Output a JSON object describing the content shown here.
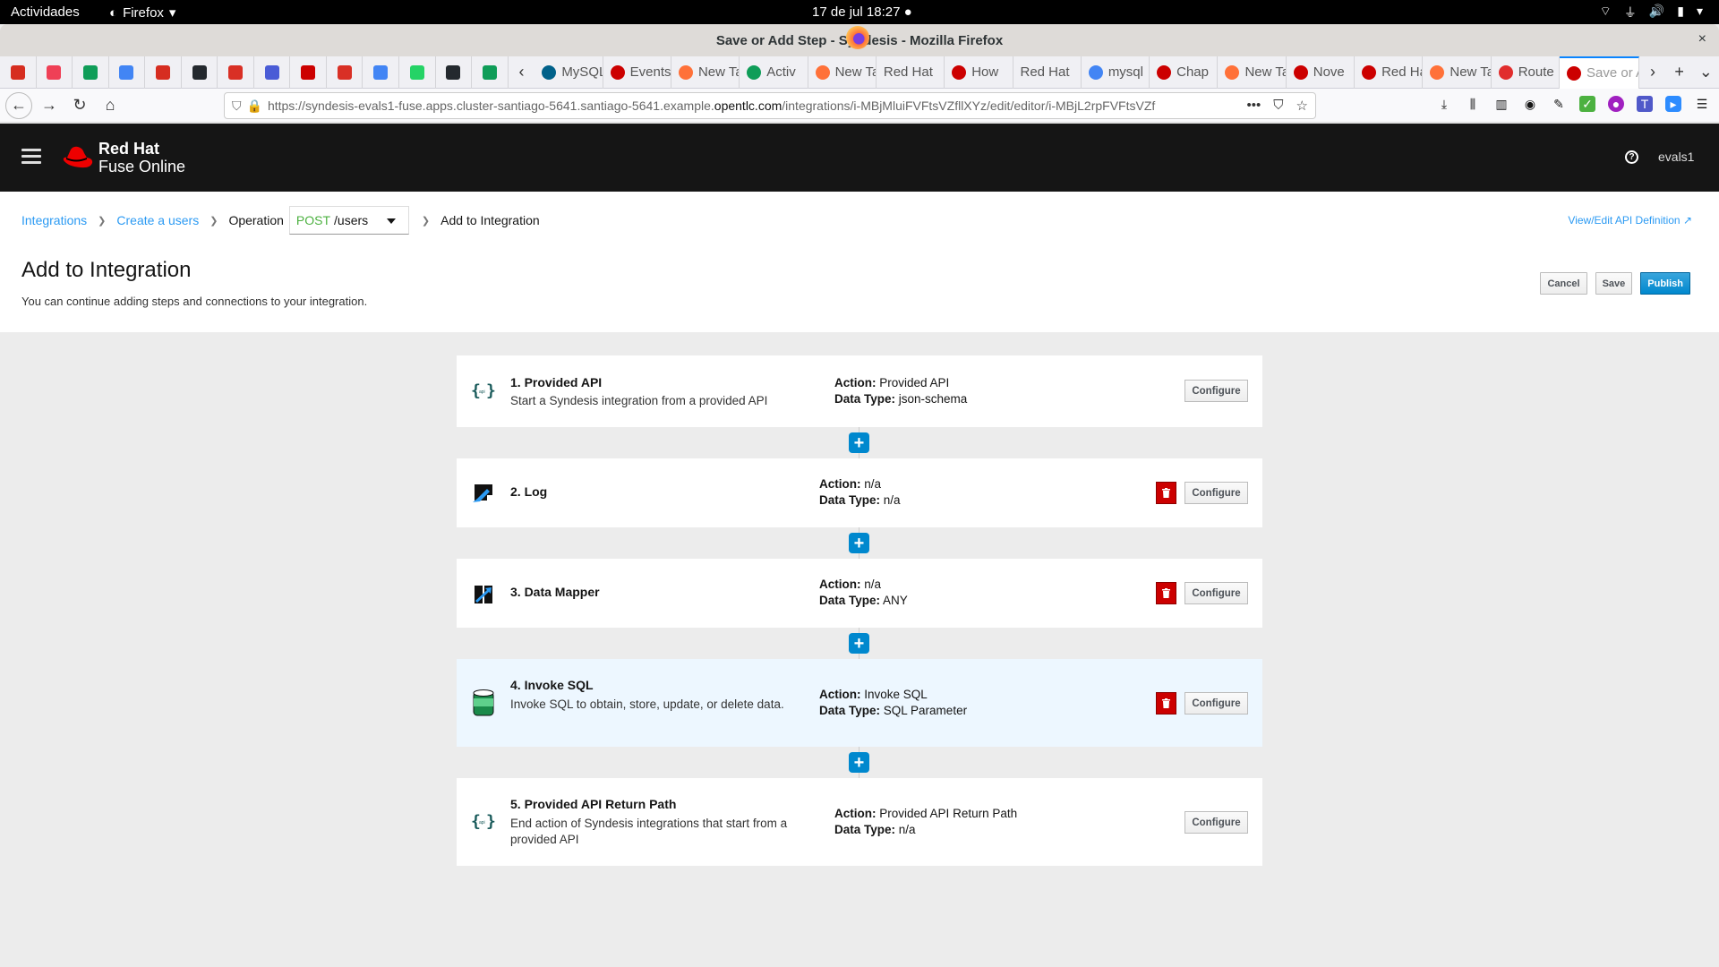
{
  "os_bar": {
    "activities": "Actividades",
    "app": "Firefox",
    "clock": "17 de jul  18:27 ●"
  },
  "window": {
    "title": "Save or Add Step - Syndesis - Mozilla Firefox",
    "close": "×"
  },
  "browser": {
    "pinned_tabs": [
      {
        "icon": "red-pin-icon",
        "color": "#d62d20"
      },
      {
        "icon": "pocket-icon",
        "color": "#ef4056"
      },
      {
        "icon": "hangouts-icon",
        "color": "#0f9d58"
      },
      {
        "icon": "docs-icon",
        "color": "#4285f4"
      },
      {
        "icon": "red-pin-icon",
        "color": "#d62d20"
      },
      {
        "icon": "github-icon",
        "color": "#24292e"
      },
      {
        "icon": "gmail-icon",
        "color": "#d93025"
      },
      {
        "icon": "calendar-icon",
        "color": "#4a5cd6"
      },
      {
        "icon": "redhat-icon",
        "color": "#cc0000"
      },
      {
        "icon": "gmail-icon",
        "color": "#d93025"
      },
      {
        "icon": "translate-icon",
        "color": "#4285f4"
      },
      {
        "icon": "whatsapp-icon",
        "color": "#25d366"
      },
      {
        "icon": "github-icon",
        "color": "#24292e"
      },
      {
        "icon": "sheets-icon",
        "color": "#0f9d58"
      }
    ],
    "tabs": [
      {
        "label": "MySQL",
        "fav": "#00618a"
      },
      {
        "label": "Events",
        "fav": "#cc0000"
      },
      {
        "label": "New Tab",
        "fav": "#ff7139"
      },
      {
        "label": "Activ",
        "fav": "#0f9d58"
      },
      {
        "label": "New Tab",
        "fav": "#ff7139"
      },
      {
        "label": "Red Hat",
        "fav": ""
      },
      {
        "label": "How",
        "fav": "#cc0000"
      },
      {
        "label": "Red Hat",
        "fav": ""
      },
      {
        "label": "mysql",
        "fav": "#4285f4"
      },
      {
        "label": "Chap",
        "fav": "#cc0000"
      },
      {
        "label": "New Tab",
        "fav": "#ff7139"
      },
      {
        "label": "Nove",
        "fav": "#cc0000"
      },
      {
        "label": "Red Hat",
        "fav": "#cc0000"
      },
      {
        "label": "New Tab",
        "fav": "#ff7139"
      },
      {
        "label": "Route",
        "fav": "#e12d2d"
      },
      {
        "label": "Save or Add Step",
        "fav": "#cc0000",
        "active": true
      }
    ],
    "url_prefix": "https://syndesis-evals1-fuse.apps.cluster-santiago-5641.santiago-5641.example.",
    "url_domain": "opentlc.com",
    "url_path": "/integrations/i-MBjMluiFVFtsVZfllXYz/edit/editor/i-MBjL2rpFVFtsVZf"
  },
  "app": {
    "brand_line1": "Red Hat",
    "brand_line2": "Fuse Online",
    "user": "evals1"
  },
  "breadcrumb": {
    "items": [
      "Integrations",
      "Create a users"
    ],
    "operation_label": "Operation",
    "operation_method": "POST",
    "operation_path": " /users",
    "current": "Add to Integration",
    "api_link": "View/Edit API Definition"
  },
  "page": {
    "title": "Add to Integration",
    "subtitle": "You can continue adding steps and connections to your integration.",
    "cancel": "Cancel",
    "save": "Save",
    "publish": "Publish"
  },
  "labels": {
    "action": "Action:",
    "datatype": "Data Type:",
    "configure": "Configure"
  },
  "steps": [
    {
      "title": "1. Provided API",
      "desc": "Start a Syndesis integration from a provided API",
      "action": "Provided API",
      "datatype": "json-schema",
      "icon": "api-icon",
      "deletable": false
    },
    {
      "title": "2. Log",
      "desc": "",
      "action": "n/a",
      "datatype": "n/a",
      "icon": "log-icon",
      "deletable": true
    },
    {
      "title": "3. Data Mapper",
      "desc": "",
      "action": "n/a",
      "datatype": "ANY",
      "icon": "data-mapper-icon",
      "deletable": true
    },
    {
      "title": "4. Invoke SQL",
      "desc": "Invoke SQL to obtain, store, update, or delete data.",
      "action": "Invoke SQL",
      "datatype": "SQL Parameter",
      "icon": "database-icon",
      "deletable": true,
      "highlighted": true
    },
    {
      "title": "5. Provided API Return Path",
      "desc": "End action of Syndesis integrations that start from a provided API",
      "action": "Provided API Return Path",
      "datatype": "n/a",
      "icon": "api-icon",
      "deletable": false
    }
  ],
  "colors": {
    "accent": "#0088ce",
    "link": "#2b9af3",
    "danger": "#cc0000",
    "method_post": "#4cb140"
  }
}
